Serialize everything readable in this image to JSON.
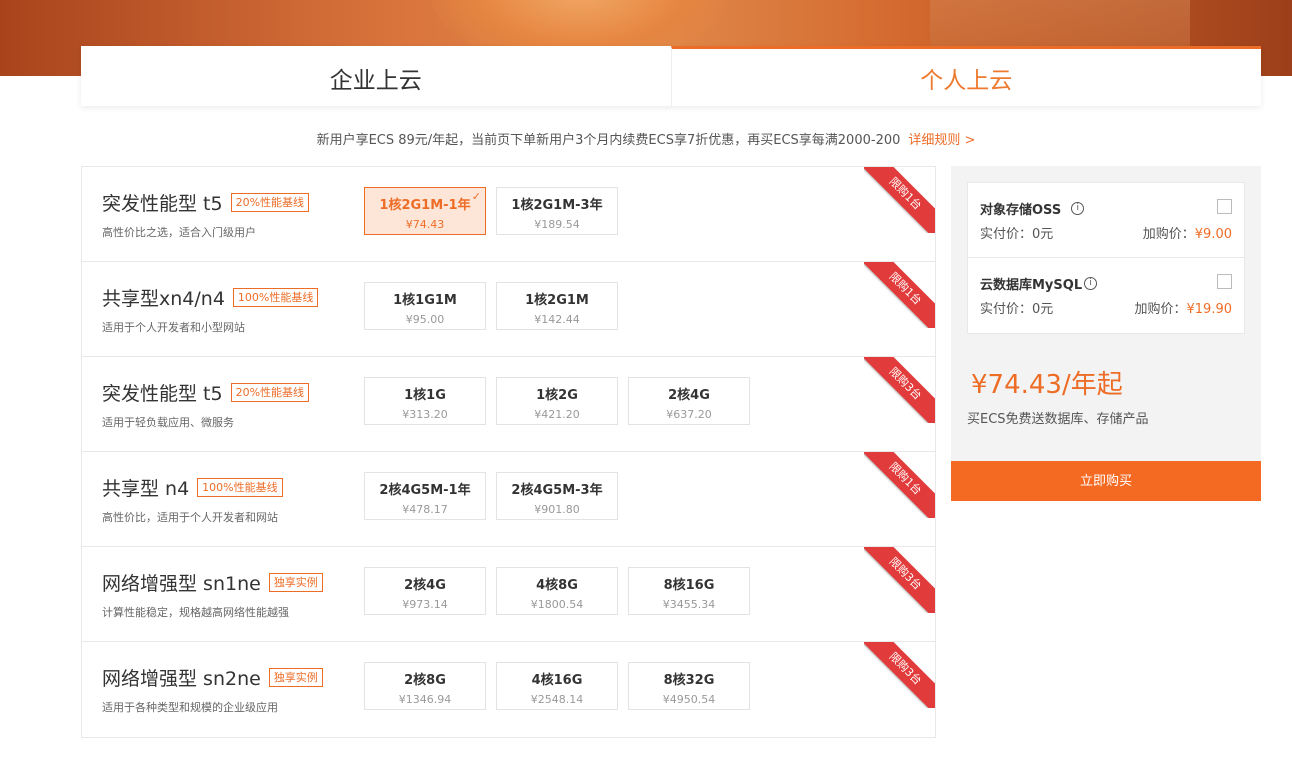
{
  "tabs": [
    {
      "label": "企业上云"
    },
    {
      "label": "个人上云"
    }
  ],
  "notice": {
    "text": "新用户享ECS 89元/年起，当前页下单新用户3个月内续费ECS享7折优惠，再买ECS享每满2000-200",
    "link": "详细规则 >"
  },
  "products": [
    {
      "name": "突发性能型 t5",
      "tag": "20%性能基线",
      "desc": "高性价比之选，适合入门级用户",
      "ribbon": "限购1台",
      "options": [
        {
          "name": "1核2G1M-1年",
          "price": "¥74.43"
        },
        {
          "name": "1核2G1M-3年",
          "price": "¥189.54"
        }
      ]
    },
    {
      "name": "共享型xn4/n4",
      "tag": "100%性能基线",
      "desc": "适用于个人开发者和小型网站",
      "ribbon": "限购1台",
      "options": [
        {
          "name": "1核1G1M",
          "price": "¥95.00"
        },
        {
          "name": "1核2G1M",
          "price": "¥142.44"
        }
      ]
    },
    {
      "name": "突发性能型 t5",
      "tag": "20%性能基线",
      "desc": "适用于轻负载应用、微服务",
      "ribbon": "限购3台",
      "options": [
        {
          "name": "1核1G",
          "price": "¥313.20"
        },
        {
          "name": "1核2G",
          "price": "¥421.20"
        },
        {
          "name": "2核4G",
          "price": "¥637.20"
        }
      ]
    },
    {
      "name": "共享型 n4",
      "tag": "100%性能基线",
      "desc": "高性价比，适用于个人开发者和网站",
      "ribbon": "限购1台",
      "options": [
        {
          "name": "2核4G5M-1年",
          "price": "¥478.17"
        },
        {
          "name": "2核4G5M-3年",
          "price": "¥901.80"
        }
      ]
    },
    {
      "name": "网络增强型 sn1ne",
      "tag": "独享实例",
      "desc": "计算性能稳定，规格越高网络性能越强",
      "ribbon": "限购3台",
      "options": [
        {
          "name": "2核4G",
          "price": "¥973.14"
        },
        {
          "name": "4核8G",
          "price": "¥1800.54"
        },
        {
          "name": "8核16G",
          "price": "¥3455.34"
        }
      ]
    },
    {
      "name": "网络增强型 sn2ne",
      "tag": "独享实例",
      "desc": "适用于各种类型和规模的企业级应用",
      "ribbon": "限购3台",
      "options": [
        {
          "name": "2核8G",
          "price": "¥1346.94"
        },
        {
          "name": "4核16G",
          "price": "¥2548.14"
        },
        {
          "name": "8核32G",
          "price": "¥4950.54"
        }
      ]
    }
  ],
  "addons": [
    {
      "title": "对象存储OSS",
      "actual_label": "实付价：0元",
      "plus_label": "加购价：",
      "plus_price": "¥9.00"
    },
    {
      "title": "云数据库MySQL",
      "actual_label": "实付价：0元",
      "plus_label": "加购价：",
      "plus_price": "¥19.90"
    }
  ],
  "summary": {
    "price": "¥74.43/年起",
    "note": "买ECS免费送数据库、存储产品",
    "buy_label": "立即购买"
  },
  "icons": {
    "info": "i",
    "check": "✓"
  },
  "colors": {
    "accent": "#ed6d27",
    "buy": "#f56a23",
    "ribbon": "#e23b3b"
  }
}
